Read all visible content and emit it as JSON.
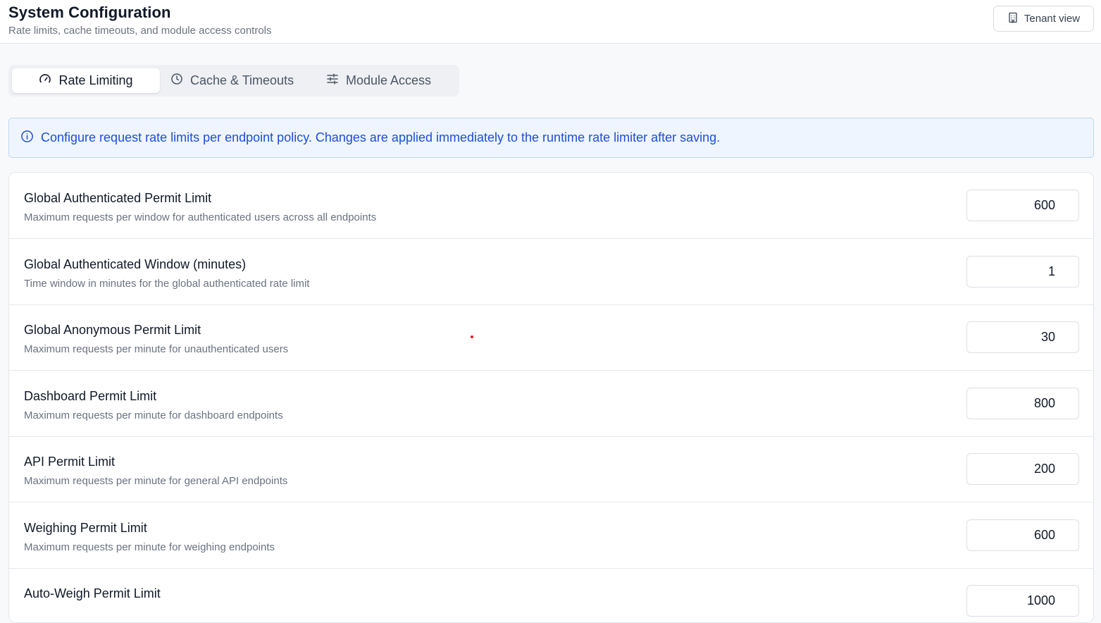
{
  "header": {
    "title": "System Configuration",
    "subtitle": "Rate limits, cache timeouts, and module access controls",
    "tenant_button": {
      "label": "Tenant view",
      "icon": "building-icon"
    }
  },
  "tabs": [
    {
      "label": "Rate Limiting",
      "icon": "gauge-icon",
      "active": true
    },
    {
      "label": "Cache & Timeouts",
      "icon": "clock-icon",
      "active": false
    },
    {
      "label": "Module Access",
      "icon": "sliders-icon",
      "active": false
    }
  ],
  "info_banner": {
    "icon": "info-icon",
    "text": "Configure request rate limits per endpoint policy. Changes are applied immediately to the runtime rate limiter after saving."
  },
  "settings": [
    {
      "title": "Global Authenticated Permit Limit",
      "description": "Maximum requests per window for authenticated users across all endpoints",
      "value": "600"
    },
    {
      "title": "Global Authenticated Window (minutes)",
      "description": "Time window in minutes for the global authenticated rate limit",
      "value": "1"
    },
    {
      "title": "Global Anonymous Permit Limit",
      "description": "Maximum requests per minute for unauthenticated users",
      "value": "30"
    },
    {
      "title": "Dashboard Permit Limit",
      "description": "Maximum requests per minute for dashboard endpoints",
      "value": "800"
    },
    {
      "title": "API Permit Limit",
      "description": "Maximum requests per minute for general API endpoints",
      "value": "200"
    },
    {
      "title": "Weighing Permit Limit",
      "description": "Maximum requests per minute for weighing endpoints",
      "value": "600"
    },
    {
      "title": "Auto-Weigh Permit Limit",
      "description": "",
      "value": "1000"
    }
  ],
  "colors": {
    "accent": "#1d4ed8",
    "banner_bg": "#eef5fe",
    "banner_border": "#bcd7f5"
  }
}
